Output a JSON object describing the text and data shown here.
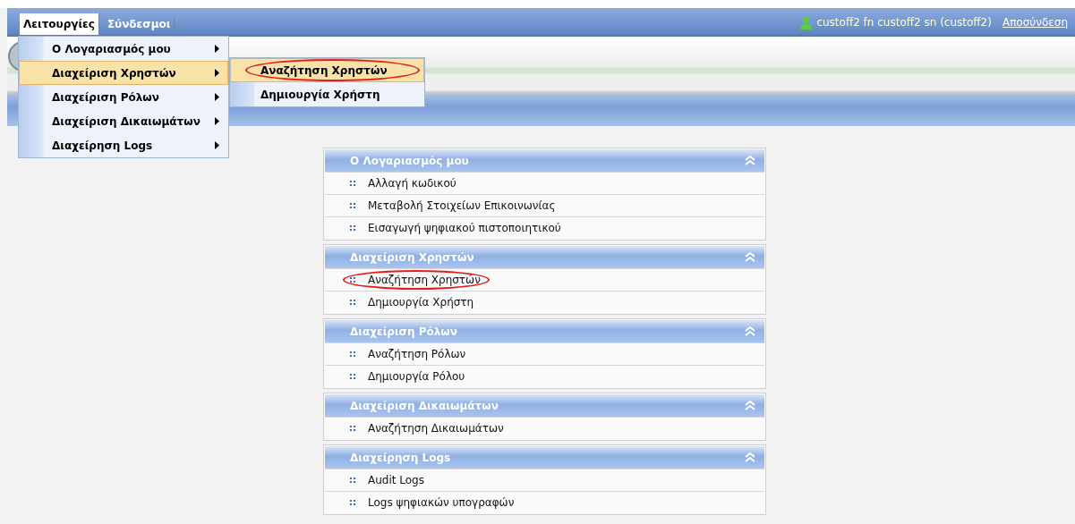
{
  "menubar": {
    "tabs": [
      {
        "label": "Λειτουργίες",
        "selected": true
      },
      {
        "label": "Σύνδεσμοι",
        "selected": false
      }
    ]
  },
  "user": {
    "name": "custoff2 fn custoff2 sn (custoff2)",
    "logout": "Αποσύνδεση"
  },
  "dropdown": {
    "items": [
      {
        "label": "Ο Λογαριασμός μου",
        "selected": false
      },
      {
        "label": "Διαχείριση Χρηστών",
        "selected": true
      },
      {
        "label": "Διαχείριση Ρόλων",
        "selected": false
      },
      {
        "label": "Διαχείριση Δικαιωμάτων",
        "selected": false
      },
      {
        "label": "Διαχείρηση Logs",
        "selected": false
      }
    ]
  },
  "submenu": {
    "items": [
      {
        "label": "Αναζήτηση Χρηστών",
        "selected": true,
        "circled": true
      },
      {
        "label": "Δημιουργία Χρήστη",
        "selected": false,
        "circled": false
      }
    ]
  },
  "panels": [
    {
      "title": "Ο Λογαριασμός μου",
      "expanded": true,
      "links": [
        {
          "label": "Αλλαγή κωδικού",
          "circled": false
        },
        {
          "label": "Μεταβολή Στοιχείων Επικοινωνίας",
          "circled": false
        },
        {
          "label": "Εισαγωγή ψηφιακού πιστοποιητικού",
          "circled": false
        }
      ]
    },
    {
      "title": "Διαχείριση Χρηστών",
      "expanded": true,
      "links": [
        {
          "label": "Αναζήτηση Χρηστών",
          "circled": true
        },
        {
          "label": "Δημιουργία Χρήστη",
          "circled": false
        }
      ]
    },
    {
      "title": "Διαχείριση Ρόλων",
      "expanded": true,
      "links": [
        {
          "label": "Αναζήτηση Ρόλων",
          "circled": false
        },
        {
          "label": "Δημιουργία Ρόλου",
          "circled": false
        }
      ]
    },
    {
      "title": "Διαχείριση Δικαιωμάτων",
      "expanded": true,
      "links": [
        {
          "label": "Αναζήτηση Δικαιωμάτων",
          "circled": false
        }
      ]
    },
    {
      "title": "Διαχείρηση Logs",
      "expanded": true,
      "links": [
        {
          "label": "Audit Logs",
          "circled": false
        },
        {
          "label": "Logs ψηφιακών υπογραφών",
          "circled": false
        }
      ]
    }
  ]
}
